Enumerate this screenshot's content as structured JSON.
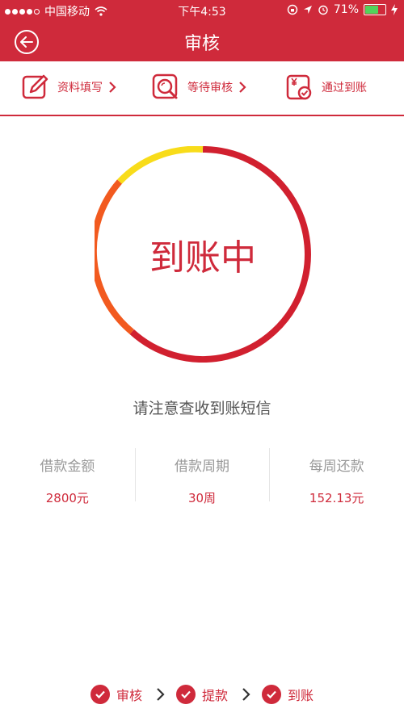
{
  "status_bar": {
    "carrier": "中国移动",
    "time": "下午4:53",
    "battery_percent": "71%",
    "battery_level": 0.71
  },
  "header": {
    "title": "审核"
  },
  "steps": [
    {
      "label": "资料填写",
      "icon": "edit-icon"
    },
    {
      "label": "等待审核",
      "icon": "search-review-icon"
    },
    {
      "label": "通过到账",
      "icon": "money-check-icon"
    }
  ],
  "ring": {
    "text": "到账中"
  },
  "notice": "请注意查收到账短信",
  "info": [
    {
      "label": "借款金额",
      "value": "2800元"
    },
    {
      "label": "借款周期",
      "value": "30周"
    },
    {
      "label": "每周还款",
      "value": "152.13元"
    }
  ],
  "bottom_flow": [
    "审核",
    "提款",
    "到账"
  ],
  "colors": {
    "primary": "#cf2a3b",
    "ring_orange": "#f25a1f",
    "ring_yellow": "#f8dc1a",
    "battery": "#52d35b"
  }
}
